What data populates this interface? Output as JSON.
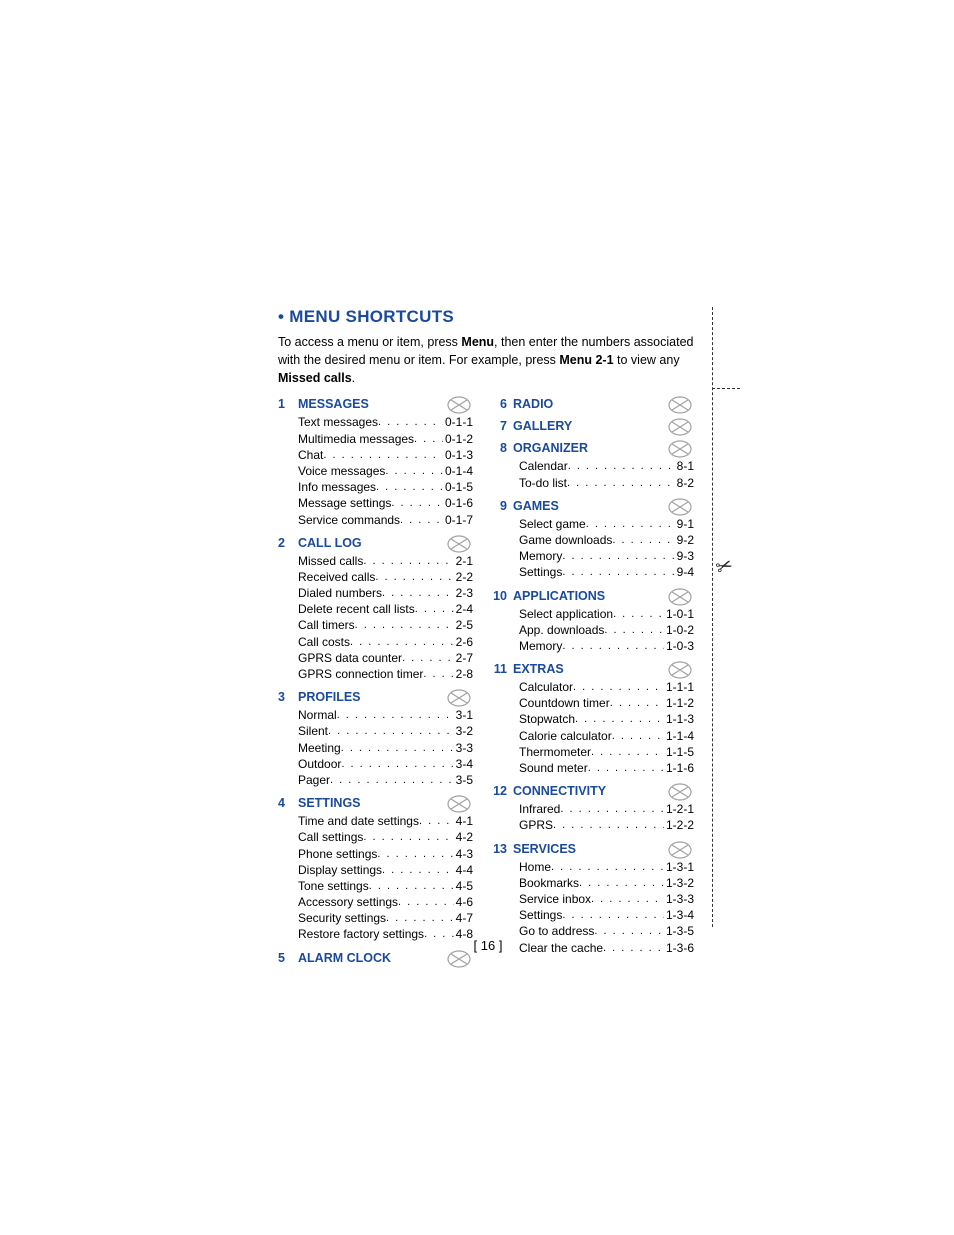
{
  "title": "MENU SHORTCUTS",
  "intro_a": "To access a menu or item, press ",
  "intro_menu": "Menu",
  "intro_b": ", then enter the numbers associated with the desired menu or item. For example, press ",
  "intro_menu21": "Menu 2-1",
  "intro_c": " to view any ",
  "intro_missed": "Missed calls",
  "intro_d": ".",
  "page_number": "[ 16 ]",
  "left": [
    {
      "num": "1",
      "title": "MESSAGES",
      "icon": "messages-icon",
      "items": [
        {
          "label": "Text messages",
          "code": "0-1-1"
        },
        {
          "label": "Multimedia messages",
          "code": "0-1-2"
        },
        {
          "label": "Chat",
          "code": "0-1-3"
        },
        {
          "label": "Voice messages",
          "code": "0-1-4"
        },
        {
          "label": "Info messages",
          "code": "0-1-5"
        },
        {
          "label": "Message settings",
          "code": "0-1-6"
        },
        {
          "label": "Service commands",
          "code": "0-1-7"
        }
      ]
    },
    {
      "num": "2",
      "title": "CALL LOG",
      "icon": "call-log-icon",
      "items": [
        {
          "label": "Missed calls",
          "code": "2-1"
        },
        {
          "label": "Received calls",
          "code": "2-2"
        },
        {
          "label": "Dialed numbers",
          "code": "2-3"
        },
        {
          "label": "Delete recent call lists",
          "code": "2-4"
        },
        {
          "label": "Call timers",
          "code": "2-5"
        },
        {
          "label": "Call costs",
          "code": "2-6"
        },
        {
          "label": "GPRS data counter",
          "code": "2-7"
        },
        {
          "label": "GPRS connection timer",
          "code": "2-8"
        }
      ]
    },
    {
      "num": "3",
      "title": "PROFILES",
      "icon": "profiles-icon",
      "items": [
        {
          "label": "Normal",
          "code": "3-1"
        },
        {
          "label": "Silent",
          "code": "3-2"
        },
        {
          "label": "Meeting",
          "code": "3-3"
        },
        {
          "label": "Outdoor",
          "code": "3-4"
        },
        {
          "label": "Pager",
          "code": "3-5"
        }
      ]
    },
    {
      "num": "4",
      "title": "SETTINGS",
      "icon": "settings-icon",
      "items": [
        {
          "label": "Time and date settings",
          "code": "4-1"
        },
        {
          "label": "Call settings",
          "code": "4-2"
        },
        {
          "label": "Phone settings",
          "code": "4-3"
        },
        {
          "label": "Display settings",
          "code": "4-4"
        },
        {
          "label": "Tone settings",
          "code": "4-5"
        },
        {
          "label": "Accessory settings",
          "code": "4-6"
        },
        {
          "label": "Security settings",
          "code": "4-7"
        },
        {
          "label": "Restore factory settings",
          "code": "4-8"
        }
      ]
    },
    {
      "num": "5",
      "title": "ALARM CLOCK",
      "icon": "alarm-clock-icon",
      "items": []
    }
  ],
  "right": [
    {
      "num": "6",
      "title": "RADIO",
      "icon": "radio-icon",
      "items": []
    },
    {
      "num": "7",
      "title": "GALLERY",
      "icon": "gallery-icon",
      "items": []
    },
    {
      "num": "8",
      "title": "ORGANIZER",
      "icon": "organizer-icon",
      "items": [
        {
          "label": "Calendar",
          "code": "8-1"
        },
        {
          "label": "To-do list",
          "code": "8-2"
        }
      ]
    },
    {
      "num": "9",
      "title": "GAMES",
      "icon": "games-icon",
      "items": [
        {
          "label": "Select game",
          "code": "9-1"
        },
        {
          "label": "Game downloads",
          "code": "9-2"
        },
        {
          "label": "Memory",
          "code": "9-3"
        },
        {
          "label": "Settings",
          "code": "9-4"
        }
      ]
    },
    {
      "num": "10",
      "title": "APPLICATIONS",
      "icon": "applications-icon",
      "items": [
        {
          "label": "Select application",
          "code": "1-0-1"
        },
        {
          "label": "App. downloads",
          "code": "1-0-2"
        },
        {
          "label": "Memory",
          "code": "1-0-3"
        }
      ]
    },
    {
      "num": "11",
      "title": "EXTRAS",
      "icon": "extras-icon",
      "items": [
        {
          "label": "Calculator",
          "code": "1-1-1"
        },
        {
          "label": "Countdown timer",
          "code": "1-1-2"
        },
        {
          "label": "Stopwatch",
          "code": "1-1-3"
        },
        {
          "label": "Calorie calculator",
          "code": "1-1-4"
        },
        {
          "label": "Thermometer",
          "code": "1-1-5"
        },
        {
          "label": "Sound meter",
          "code": "1-1-6"
        }
      ]
    },
    {
      "num": "12",
      "title": "CONNECTIVITY",
      "icon": "connectivity-icon",
      "items": [
        {
          "label": "Infrared",
          "code": "1-2-1"
        },
        {
          "label": "GPRS",
          "code": "1-2-2"
        }
      ]
    },
    {
      "num": "13",
      "title": "SERVICES",
      "icon": "services-icon",
      "items": [
        {
          "label": "Home",
          "code": "1-3-1"
        },
        {
          "label": "Bookmarks",
          "code": "1-3-2"
        },
        {
          "label": "Service inbox",
          "code": "1-3-3"
        },
        {
          "label": "Settings",
          "code": "1-3-4"
        },
        {
          "label": "Go to address",
          "code": "1-3-5"
        },
        {
          "label": "Clear the cache",
          "code": "1-3-6"
        }
      ]
    }
  ]
}
